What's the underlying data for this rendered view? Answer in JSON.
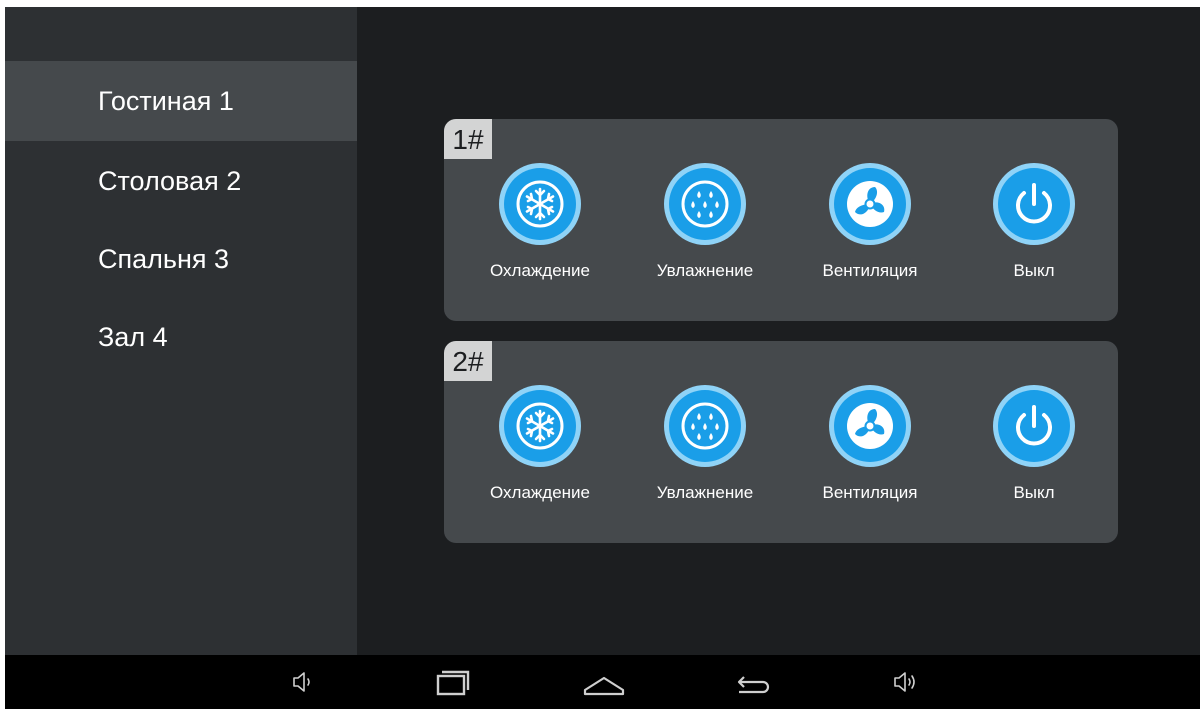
{
  "sidebar": {
    "items": [
      {
        "label": "Гостиная 1",
        "active": true
      },
      {
        "label": "Столовая 2",
        "active": false
      },
      {
        "label": "Спальня 3",
        "active": false
      },
      {
        "label": "Зал 4",
        "active": false
      }
    ]
  },
  "units": [
    {
      "label": "1#",
      "modes": [
        {
          "label": "Охлаждение",
          "icon": "snowflake-icon"
        },
        {
          "label": "Увлажнение",
          "icon": "droplets-icon"
        },
        {
          "label": "Вентиляция",
          "icon": "fan-icon"
        },
        {
          "label": "Выкл",
          "icon": "power-icon"
        }
      ]
    },
    {
      "label": "2#",
      "modes": [
        {
          "label": "Охлаждение",
          "icon": "snowflake-icon"
        },
        {
          "label": "Увлажнение",
          "icon": "droplets-icon"
        },
        {
          "label": "Вентиляция",
          "icon": "fan-icon"
        },
        {
          "label": "Выкл",
          "icon": "power-icon"
        }
      ]
    }
  ],
  "navbar": {
    "buttons": [
      "volume-down-icon",
      "recent-apps-icon",
      "home-icon",
      "back-icon",
      "volume-up-icon"
    ]
  },
  "colors": {
    "accent": "#1a9ee8",
    "accent_ring": "#8fd3f7",
    "panel": "#45494c",
    "sidebar": "#2d3033",
    "background": "#1c1e20"
  }
}
